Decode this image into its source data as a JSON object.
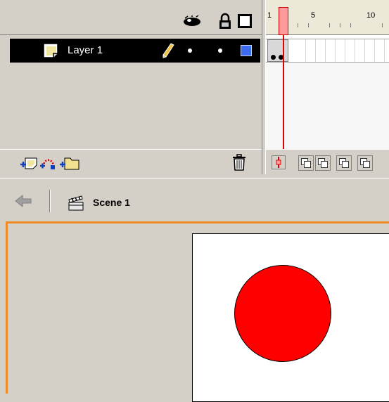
{
  "timeline": {
    "layer_header_icons": [
      "eye-icon",
      "lock-icon",
      "outline-icon"
    ],
    "layers": [
      {
        "name": "Layer 1",
        "selected": true,
        "color": "#3c6cf0"
      }
    ],
    "layer_toolbar_icons": [
      "add-layer-icon",
      "add-guide-layer-icon",
      "add-folder-icon",
      "trash-icon"
    ],
    "ruler": {
      "labels": [
        "1",
        "5",
        "10"
      ]
    },
    "current_frame": 1
  },
  "edit_bar": {
    "back_icon": "back-arrow-icon",
    "scene_icon": "clapperboard-icon",
    "scene_name": "Scene 1"
  },
  "stage": {
    "background": "#ffffff",
    "shape": {
      "type": "circle",
      "fill": "#ff0000",
      "stroke": "#000000"
    }
  },
  "colors": {
    "panel": "#d4d0c8",
    "selection": "#000000",
    "playhead": "#e00000",
    "stage_border": "#f08c28"
  }
}
